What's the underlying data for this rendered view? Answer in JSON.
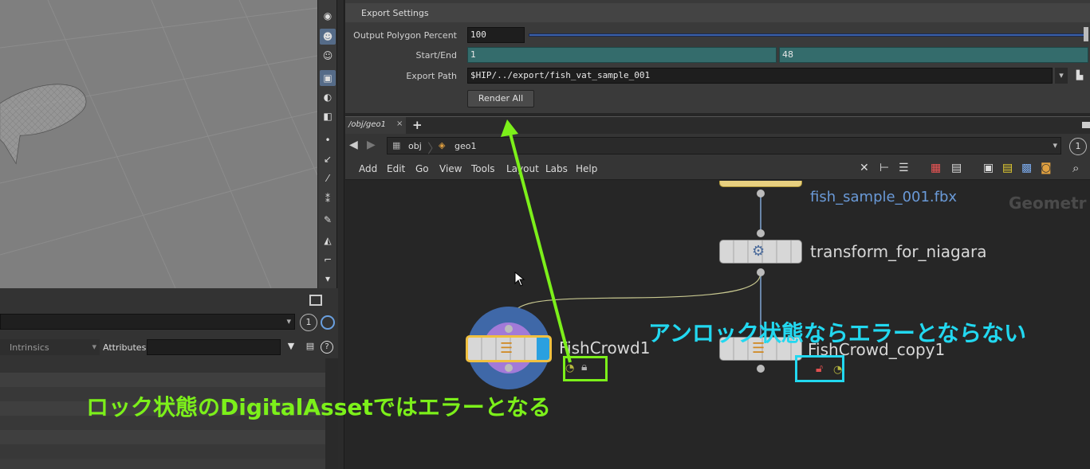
{
  "export_settings": {
    "folder_label": "Export Settings",
    "output_polygon_percent": {
      "label": "Output Polygon Percent",
      "value": "100",
      "slider_fraction": 1.0
    },
    "start_end": {
      "label": "Start/End",
      "start": "1",
      "end": "48"
    },
    "export_path": {
      "label": "Export Path",
      "value": "$HIP/../export/fish_vat_sample_001"
    },
    "render_all_label": "Render All"
  },
  "network_tab": {
    "label": "/obj/geo1",
    "close": "×",
    "add": "+"
  },
  "path_bar": {
    "obj": "obj",
    "geo": "geo1",
    "pane_number": "1"
  },
  "menu": [
    "Add",
    "Edit",
    "Go",
    "View",
    "Tools",
    "Layout",
    "Labs",
    "Help"
  ],
  "nodes": {
    "file_label": "fish_sample_001.fbx",
    "transform_label": "transform_for_niagara",
    "fishcrowd_label": "FishCrowd1",
    "fishcrowd_copy_label": "FishCrowd_copy1",
    "context_label": "Geometr"
  },
  "spreadsheet": {
    "intrinsics_label": "Intrinsics",
    "attributes_label": "Attributes:",
    "pane_number": "1"
  },
  "annotations": {
    "green": "ロック状態のDigitalAssetではエラーとなる",
    "cyan": "アンロック状態ならエラーとならない"
  },
  "colors": {
    "annotation_green": "#7cf01a",
    "annotation_cyan": "#22d8f0",
    "start_end_field": "#346c6c",
    "slider_fill": "#3a5fa8"
  }
}
